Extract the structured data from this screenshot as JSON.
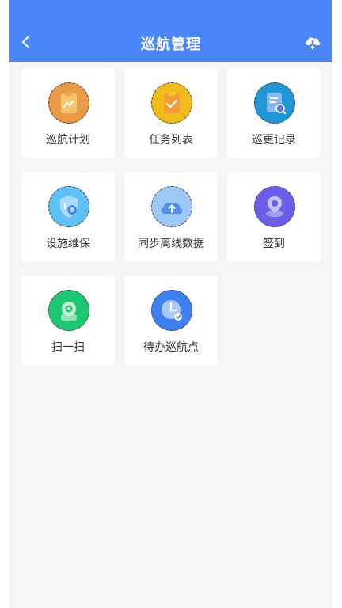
{
  "header": {
    "title": "巡航管理"
  },
  "tiles": [
    {
      "label": "巡航计划",
      "icon": "clipboard-chart-icon",
      "color": "#e89a45"
    },
    {
      "label": "任务列表",
      "icon": "clipboard-check-icon",
      "color": "#f2bb1c"
    },
    {
      "label": "巡更记录",
      "icon": "document-search-icon",
      "color": "#1f97d4"
    },
    {
      "label": "设施维保",
      "icon": "shield-settings-icon",
      "color": "#5ec0f5"
    },
    {
      "label": "同步离线数据",
      "icon": "cloud-upload-icon",
      "color": "#9cc8f5"
    },
    {
      "label": "签到",
      "icon": "location-pin-icon",
      "color": "#6b5fe8"
    },
    {
      "label": "扫一扫",
      "icon": "scan-camera-icon",
      "color": "#1ec672"
    },
    {
      "label": "待办巡航点",
      "icon": "clock-check-icon",
      "color": "#3f80f0"
    }
  ]
}
